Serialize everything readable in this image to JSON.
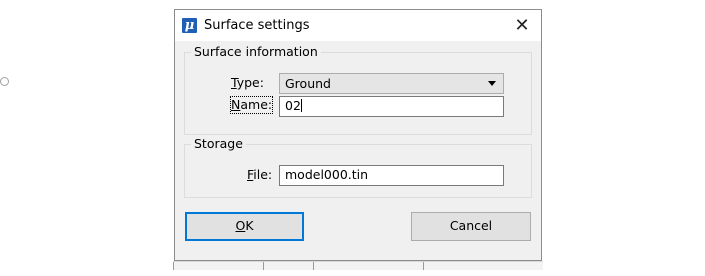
{
  "dialog": {
    "title": "Surface settings",
    "app_icon_glyph": "μ",
    "close_glyph": "✕"
  },
  "surface_information": {
    "group_label": "Surface information",
    "type": {
      "label_mnemonic": "T",
      "label_rest": "ype:",
      "selected_value": "Ground"
    },
    "name": {
      "label_mnemonic": "N",
      "label_rest": "ame:",
      "value": "02"
    }
  },
  "storage": {
    "group_label": "Storage",
    "file": {
      "label_mnemonic": "F",
      "label_rest": "ile:",
      "value": "model000.tin"
    }
  },
  "buttons": {
    "ok_mnemonic": "O",
    "ok_rest": "K",
    "cancel_label": "Cancel"
  },
  "colors": {
    "dialog_background": "#f0f0f0",
    "default_button_border": "#0078d7",
    "app_icon_background": "#1f5fb5"
  }
}
